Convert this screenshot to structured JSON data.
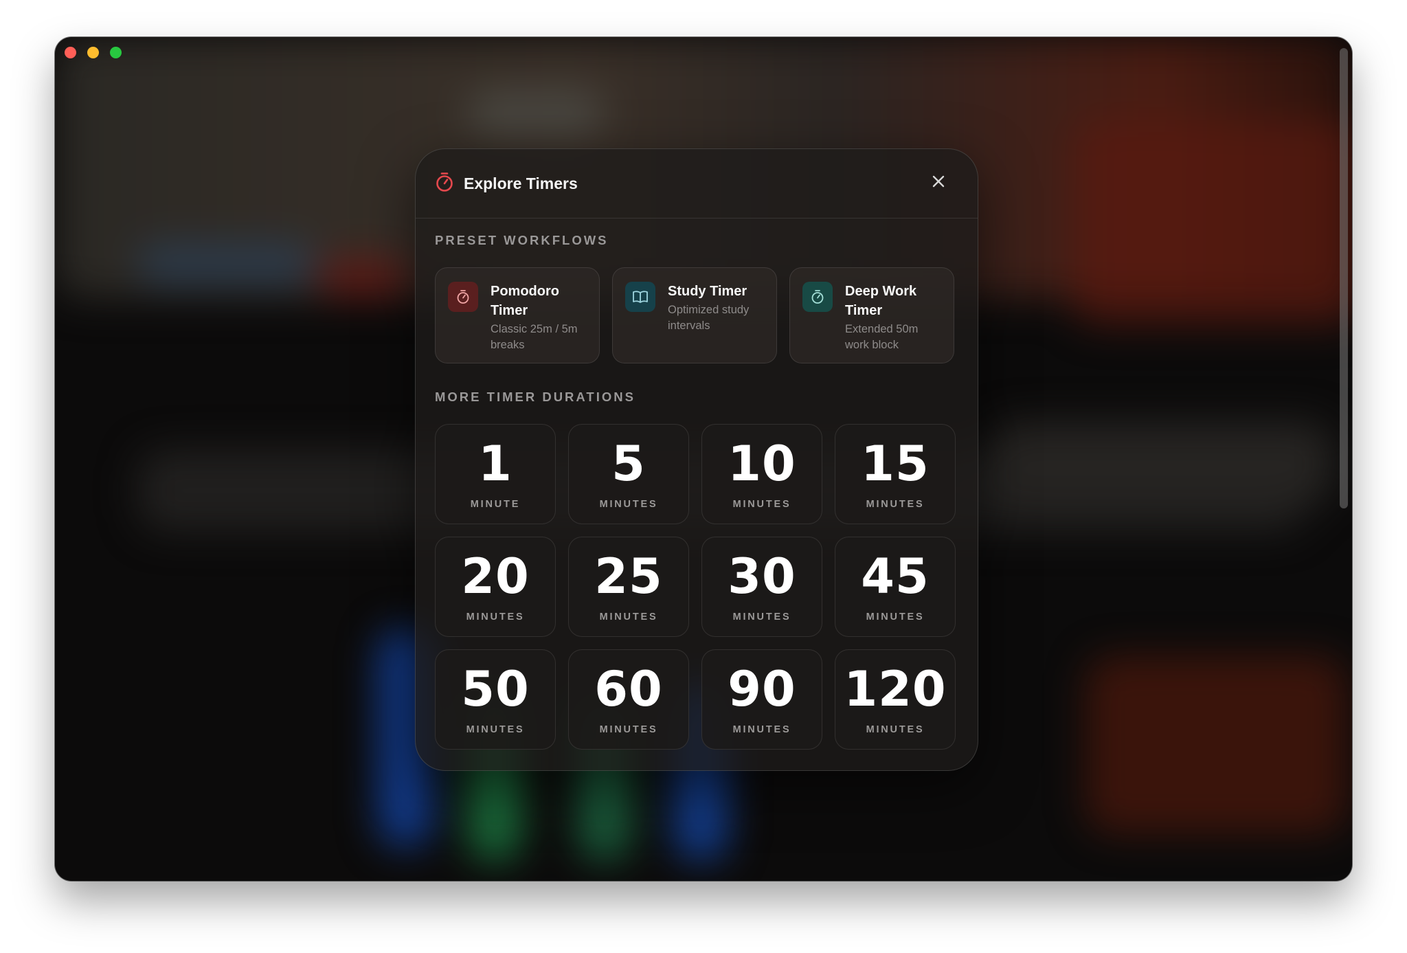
{
  "window": {
    "traffic_lights": [
      {
        "name": "close",
        "color": "#ff5f57"
      },
      {
        "name": "minimize",
        "color": "#febc2e"
      },
      {
        "name": "zoom",
        "color": "#28c840"
      }
    ]
  },
  "modal": {
    "title": "Explore Timers",
    "title_icon": "stopwatch-icon",
    "close_icon": "close-icon",
    "accent_color": "#e5484d"
  },
  "presets_section": {
    "label": "PRESET WORKFLOWS",
    "items": [
      {
        "title": "Pomodoro Timer",
        "description": "Classic 25m / 5m breaks",
        "icon": "stopwatch-icon",
        "icon_bg": "#5a1f1f",
        "icon_color": "#f2a6a6"
      },
      {
        "title": "Study Timer",
        "description": "Optimized study intervals",
        "icon": "book-icon",
        "icon_bg": "#16414a",
        "icon_color": "#9fd6e0"
      },
      {
        "title": "Deep Work Timer",
        "description": "Extended 50m work block",
        "icon": "stopwatch-icon",
        "icon_bg": "#184a45",
        "icon_color": "#a4e0d8"
      }
    ]
  },
  "durations_section": {
    "label": "MORE TIMER DURATIONS",
    "items": [
      {
        "value": "1",
        "unit": "MINUTE"
      },
      {
        "value": "5",
        "unit": "MINUTES"
      },
      {
        "value": "10",
        "unit": "MINUTES"
      },
      {
        "value": "15",
        "unit": "MINUTES"
      },
      {
        "value": "20",
        "unit": "MINUTES"
      },
      {
        "value": "25",
        "unit": "MINUTES"
      },
      {
        "value": "30",
        "unit": "MINUTES"
      },
      {
        "value": "45",
        "unit": "MINUTES"
      },
      {
        "value": "50",
        "unit": "MINUTES"
      },
      {
        "value": "60",
        "unit": "MINUTES"
      },
      {
        "value": "90",
        "unit": "MINUTES"
      },
      {
        "value": "120",
        "unit": "MINUTES"
      }
    ]
  }
}
